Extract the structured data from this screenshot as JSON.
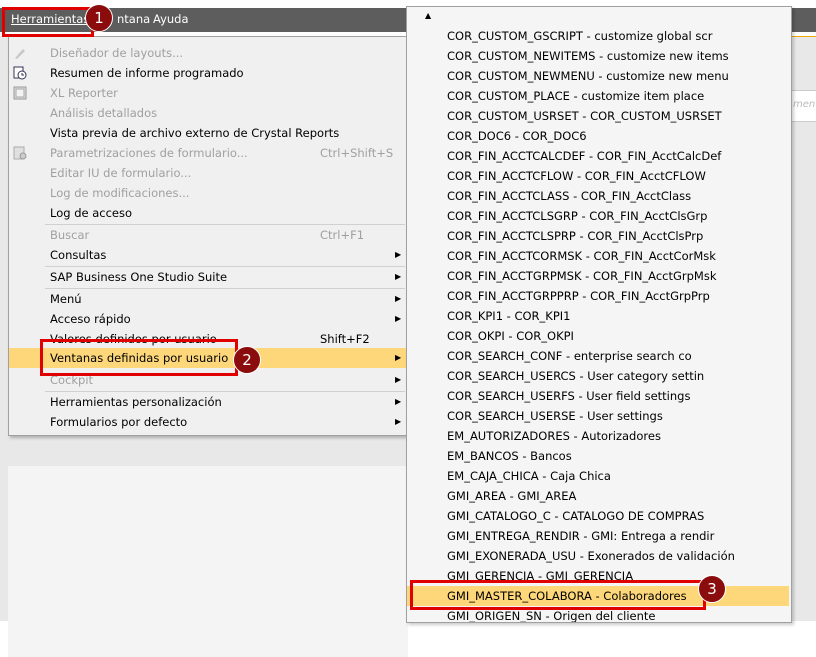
{
  "menubar": {
    "items": [
      {
        "label": "Herramientas"
      },
      {
        "label": "ntana"
      },
      {
        "label": "Ayuda"
      }
    ]
  },
  "tools_menu": {
    "items": [
      {
        "label": "Diseñador de layouts...",
        "shortcut": "",
        "disabled": true,
        "submenu": false,
        "icon": "layout-designer-icon"
      },
      {
        "label": "Resumen de informe programado",
        "shortcut": "",
        "disabled": false,
        "submenu": false,
        "icon": "scheduled-report-icon"
      },
      {
        "label": "XL Reporter",
        "shortcut": "",
        "disabled": true,
        "submenu": false,
        "icon": "xl-reporter-icon"
      },
      {
        "label": "Análisis detallados",
        "shortcut": "",
        "disabled": true,
        "submenu": false,
        "icon": ""
      },
      {
        "label": "Vista previa de archivo externo de Crystal Reports",
        "shortcut": "",
        "disabled": false,
        "submenu": false,
        "icon": ""
      },
      {
        "label": "Parametrizaciones de formulario...",
        "shortcut": "Ctrl+Shift+S",
        "disabled": true,
        "submenu": false,
        "icon": "form-settings-icon"
      },
      {
        "label": "Editar IU de formulario...",
        "shortcut": "",
        "disabled": true,
        "submenu": false,
        "icon": ""
      },
      {
        "label": "Log de modificaciones...",
        "shortcut": "",
        "disabled": true,
        "submenu": false,
        "icon": ""
      },
      {
        "label": "Log de acceso",
        "shortcut": "",
        "disabled": false,
        "submenu": false,
        "icon": ""
      },
      {
        "label": "Buscar",
        "shortcut": "Ctrl+F1",
        "disabled": true,
        "submenu": false,
        "icon": ""
      },
      {
        "label": "Consultas",
        "shortcut": "",
        "disabled": false,
        "submenu": true,
        "icon": ""
      },
      {
        "label": "SAP Business One Studio Suite",
        "shortcut": "",
        "disabled": false,
        "submenu": true,
        "icon": ""
      },
      {
        "label": "Menú",
        "shortcut": "",
        "disabled": false,
        "submenu": true,
        "icon": ""
      },
      {
        "label": "Acceso rápido",
        "shortcut": "",
        "disabled": false,
        "submenu": true,
        "icon": ""
      },
      {
        "label": "Valores definidos por usuario",
        "shortcut": "Shift+F2",
        "disabled": false,
        "submenu": false,
        "icon": ""
      },
      {
        "label": "Ventanas definidas por usuario",
        "shortcut": "",
        "disabled": false,
        "submenu": true,
        "icon": "",
        "highlighted": true
      },
      {
        "label": "Cockpit",
        "shortcut": "",
        "disabled": true,
        "submenu": true,
        "icon": ""
      },
      {
        "label": "Herramientas personalización",
        "shortcut": "",
        "disabled": false,
        "submenu": true,
        "icon": ""
      },
      {
        "label": "Formularios por defecto",
        "shortcut": "",
        "disabled": false,
        "submenu": true,
        "icon": ""
      }
    ]
  },
  "udo_submenu": {
    "items": [
      "COR_CUSTOM_GSCRIPT - customize global scr",
      "COR_CUSTOM_NEWITEMS - customize new items",
      "COR_CUSTOM_NEWMENU - customize new menu",
      "COR_CUSTOM_PLACE - customize item place",
      "COR_CUSTOM_USRSET - COR_CUSTOM_USRSET",
      "COR_DOC6 - COR_DOC6",
      "COR_FIN_ACCTCALCDEF - COR_FIN_AcctCalcDef",
      "COR_FIN_ACCTCFLOW - COR_FIN_AcctCFLOW",
      "COR_FIN_ACCTCLASS - COR_FIN_AcctClass",
      "COR_FIN_ACCTCLSGRP - COR_FIN_AcctClsGrp",
      "COR_FIN_ACCTCLSPRP - COR_FIN_AcctClsPrp",
      "COR_FIN_ACCTCORMSK - COR_FIN_AcctCorMsk",
      "COR_FIN_ACCTGRPMSK - COR_FIN_AcctGrpMsk",
      "COR_FIN_ACCTGRPPRP - COR_FIN_AcctGrpPrp",
      "COR_KPI1 - COR_KPI1",
      "COR_OKPI - COR_OKPI",
      "COR_SEARCH_CONF - enterprise search co",
      "COR_SEARCH_USERCS - User category settin",
      "COR_SEARCH_USERFS - User field settings",
      "COR_SEARCH_USERSE - User settings",
      "EM_AUTORIZADORES - Autorizadores",
      "EM_BANCOS - Bancos",
      "EM_CAJA_CHICA - Caja Chica",
      "GMI_AREA - GMI_AREA",
      "GMI_CATALOGO_C - CATALOGO DE COMPRAS",
      "GMI_ENTREGA_RENDIR - GMI: Entrega a rendir",
      "GMI_EXONERADA_USU - Exonerados de validación",
      "GMI_GERENCIA - GMI_GERENCIA",
      "GMI_MASTER_COLABORA - Colaboradores",
      "GMI_ORIGEN_SN - Origen del cliente"
    ],
    "highlighted_index": 28
  },
  "right_fragment": {
    "text": "mento"
  },
  "callouts": [
    "1",
    "2",
    "3"
  ]
}
